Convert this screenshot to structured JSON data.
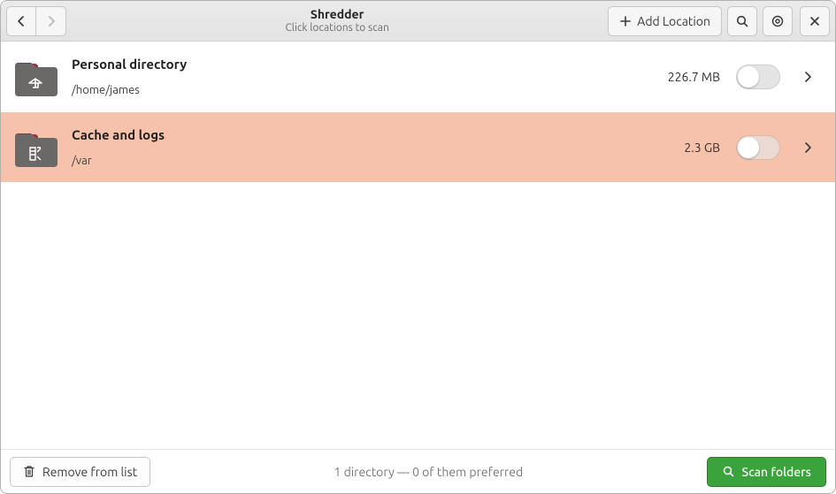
{
  "header": {
    "title": "Shredder",
    "subtitle": "Click locations to scan",
    "add_location_label": "Add Location"
  },
  "locations": [
    {
      "name": "Personal directory",
      "path": "/home/james",
      "size": "226.7 MB",
      "selected": false,
      "icon": "home"
    },
    {
      "name": "Cache and logs",
      "path": "/var",
      "size": "2.3 GB",
      "selected": true,
      "icon": "var"
    }
  ],
  "footer": {
    "remove_label": "Remove from list",
    "status": "1 directory — 0 of them preferred",
    "scan_label": "Scan folders"
  }
}
